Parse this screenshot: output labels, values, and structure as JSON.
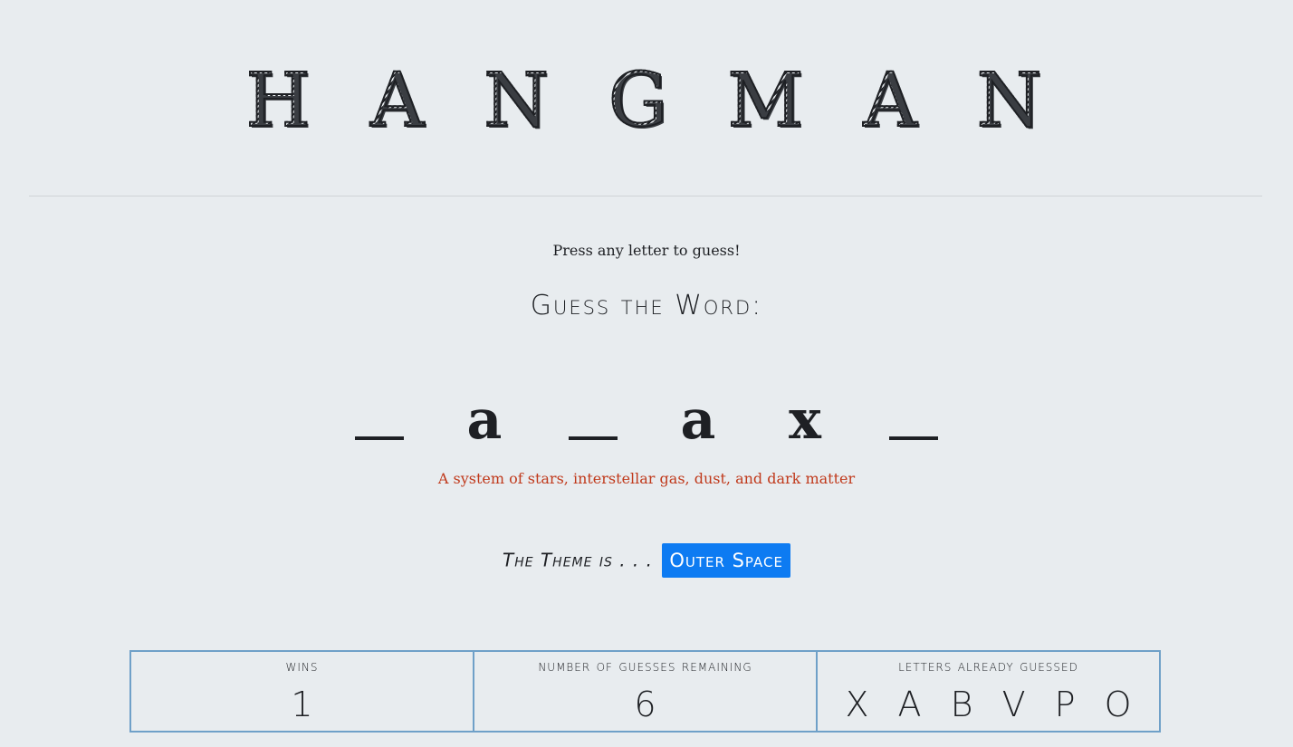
{
  "header": {
    "title": "HANGMAN"
  },
  "instruction": "Press any letter to guess!",
  "guess_heading": "Guess the Word:",
  "word": {
    "slots": [
      "_",
      "a",
      "_",
      "a",
      "x",
      "_"
    ]
  },
  "hint": "A system of stars, interstellar gas, dust, and dark matter",
  "theme": {
    "label": "The Theme is . . .",
    "value": "Outer Space",
    "badge_color": "#0d7bf2"
  },
  "stats": {
    "wins_label": "WINS",
    "wins_value": "1",
    "guesses_label": "NUMBER OF GUESSES REMAINING",
    "guesses_value": "6",
    "letters_label": "LETTERS ALREADY GUESSED",
    "letters_value": "X A B V P O"
  },
  "colors": {
    "background": "#e8ecef",
    "hint_text": "#c0391b",
    "stats_border": "#6fa0c8"
  }
}
